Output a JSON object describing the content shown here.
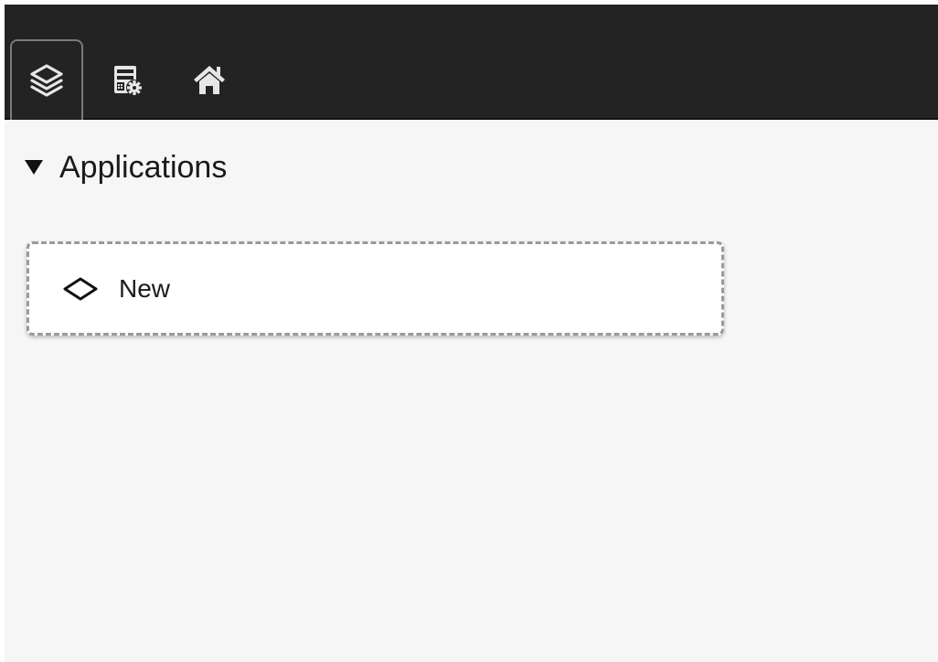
{
  "toolbar": {
    "tabs": [
      {
        "icon": "layers-icon",
        "active": true
      },
      {
        "icon": "server-settings-icon",
        "active": false
      },
      {
        "icon": "home-icon",
        "active": false
      }
    ]
  },
  "section": {
    "title": "Applications",
    "expanded": true
  },
  "new_card": {
    "label": "New",
    "icon": "diamond-icon"
  },
  "colors": {
    "toolbar_bg": "#232323",
    "content_bg": "#f6f6f6",
    "card_bg": "#ffffff",
    "card_border": "#9a9a9a",
    "icon_color": "#e6e6e6"
  }
}
